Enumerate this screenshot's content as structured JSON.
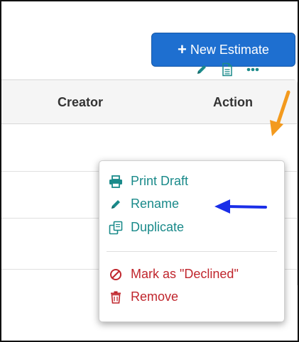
{
  "toolbar": {
    "new_estimate_plus": "+",
    "new_estimate_label": "New Estimate"
  },
  "table": {
    "headers": {
      "creator": "Creator",
      "action": "Action"
    }
  },
  "row_actions": {
    "edit_icon": "pencil-icon",
    "document_icon": "document-icon",
    "more_icon": "ellipsis-icon"
  },
  "menu": {
    "items": [
      {
        "label": "Print Draft",
        "icon": "printer-icon"
      },
      {
        "label": "Rename",
        "icon": "pencil-icon"
      },
      {
        "label": "Duplicate",
        "icon": "duplicate-icon"
      },
      {
        "label": "Mark as \"Declined\"",
        "icon": "ban-icon"
      },
      {
        "label": "Remove",
        "icon": "trash-icon"
      }
    ]
  },
  "colors": {
    "primary": "#1e6fd0",
    "teal": "#1a8a8a",
    "danger": "#c0262d",
    "annotation_orange": "#f39a1e",
    "annotation_blue": "#1a2ee8"
  }
}
